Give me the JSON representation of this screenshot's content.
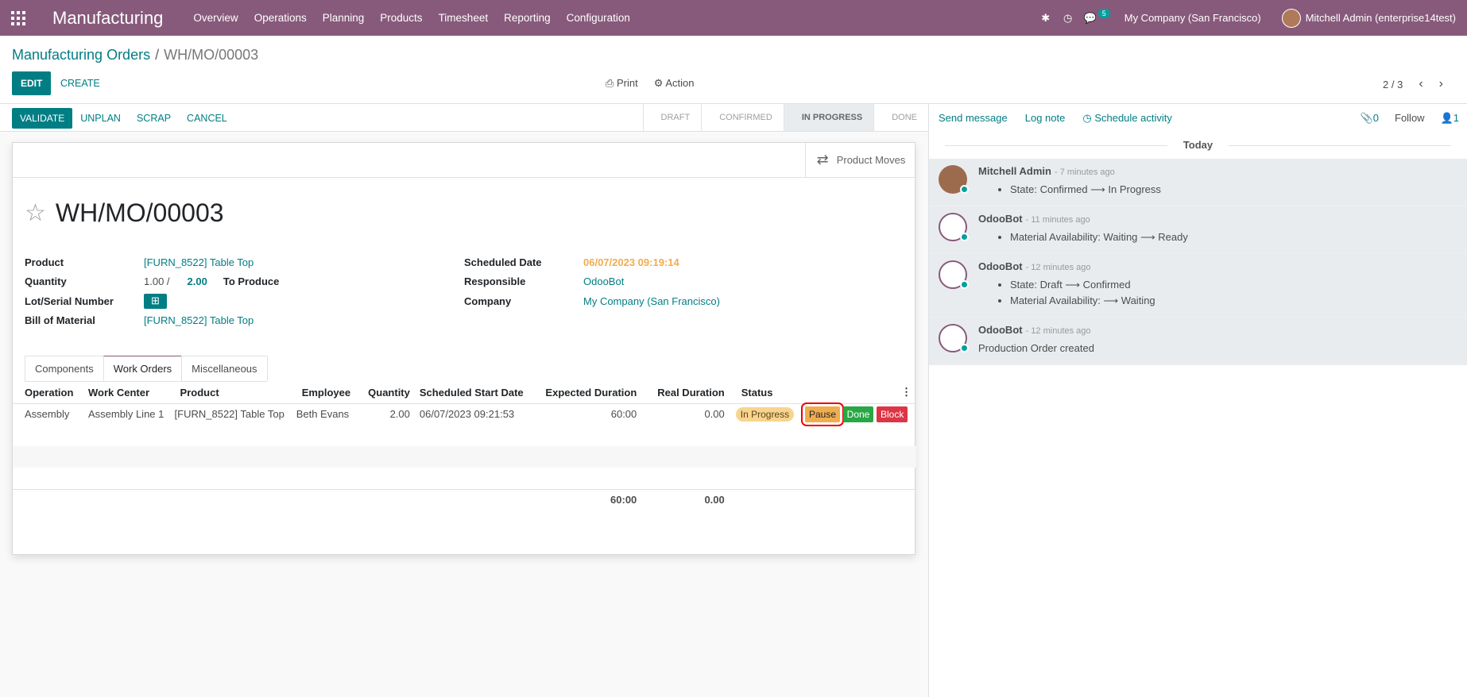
{
  "navbar": {
    "app_name": "Manufacturing",
    "menu": [
      "Overview",
      "Operations",
      "Planning",
      "Products",
      "Timesheet",
      "Reporting",
      "Configuration"
    ],
    "message_count": "5",
    "company": "My Company (San Francisco)",
    "user": "Mitchell Admin (enterprise14test)"
  },
  "breadcrumb": {
    "parent": "Manufacturing Orders",
    "current": "WH/MO/00003"
  },
  "control": {
    "edit": "EDIT",
    "create": "CREATE",
    "print": "Print",
    "action": "Action",
    "pager": "2 / 3"
  },
  "statusbar": {
    "buttons": [
      "VALIDATE",
      "UNPLAN",
      "SCRAP",
      "CANCEL"
    ],
    "stages": [
      "DRAFT",
      "CONFIRMED",
      "IN PROGRESS",
      "DONE"
    ],
    "active_stage": "IN PROGRESS"
  },
  "sheet": {
    "product_moves": "Product Moves",
    "title": "WH/MO/00003",
    "left_fields": {
      "product_label": "Product",
      "product": "[FURN_8522] Table Top",
      "quantity_label": "Quantity",
      "quantity": "1.00 /",
      "quantity_target": "2.00",
      "to_produce": "To Produce",
      "lot_label": "Lot/Serial Number",
      "bom_label": "Bill of Material",
      "bom": "[FURN_8522] Table Top"
    },
    "right_fields": {
      "scheduled_label": "Scheduled Date",
      "scheduled": "06/07/2023 09:19:14",
      "responsible_label": "Responsible",
      "responsible": "OdooBot",
      "company_label": "Company",
      "company": "My Company (San Francisco)"
    },
    "tabs": [
      "Components",
      "Work Orders",
      "Miscellaneous"
    ],
    "active_tab": "Work Orders",
    "table": {
      "headers": [
        "Operation",
        "Work Center",
        "Product",
        "Employee",
        "Quantity",
        "Scheduled Start Date",
        "Expected Duration",
        "Real Duration",
        "Status"
      ],
      "row": {
        "operation": "Assembly",
        "work_center": "Assembly Line 1",
        "product": "[FURN_8522] Table Top",
        "employee": "Beth Evans",
        "quantity": "2.00",
        "start": "06/07/2023 09:21:53",
        "expected": "60:00",
        "real": "0.00",
        "status": "In Progress",
        "pause": "Pause",
        "done": "Done",
        "block": "Block"
      },
      "total_expected": "60:00",
      "total_real": "0.00"
    }
  },
  "chatter": {
    "send_message": "Send message",
    "log_note": "Log note",
    "schedule": "Schedule activity",
    "attachments": "0",
    "follow": "Follow",
    "followers": "1",
    "day": "Today",
    "messages": [
      {
        "author": "Mitchell Admin",
        "time": "- 7 minutes ago",
        "lines": [
          "State: Confirmed ⟶ In Progress"
        ]
      },
      {
        "author": "OdooBot",
        "time": "- 11 minutes ago",
        "lines": [
          "Material Availability: Waiting ⟶ Ready"
        ]
      },
      {
        "author": "OdooBot",
        "time": "- 12 minutes ago",
        "lines": [
          "State: Draft ⟶ Confirmed",
          "Material Availability: ⟶ Waiting"
        ]
      },
      {
        "author": "OdooBot",
        "time": "- 12 minutes ago",
        "body": "Production Order created"
      }
    ]
  }
}
